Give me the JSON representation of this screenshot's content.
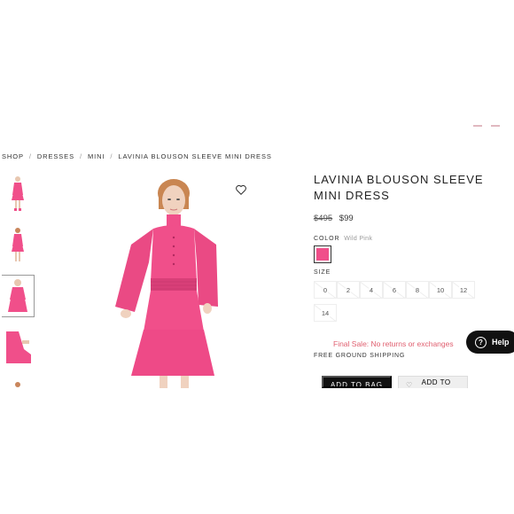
{
  "breadcrumb": [
    {
      "label": "SHOP"
    },
    {
      "label": "DRESSES"
    },
    {
      "label": "MINI"
    },
    {
      "label": "LAVINIA BLOUSON SLEEVE MINI DRESS"
    }
  ],
  "product": {
    "title": "LAVINIA BLOUSON SLEEVE MINI DRESS",
    "price_original": "$495",
    "price_sale": "$99",
    "color_label": "COLOR",
    "color_value": "Wild Pink",
    "swatch_color": "#f04f8a",
    "size_label": "SIZE",
    "sizes": [
      "0",
      "2",
      "4",
      "6",
      "8",
      "10",
      "12",
      "14"
    ],
    "final_sale": "Final Sale: No returns or exchanges",
    "shipping": "FREE GROUND SHIPPING",
    "add_to_bag": "ADD TO BAG",
    "add_to": "ADD TO"
  },
  "gallery": {
    "wishlist_icon": "heart-icon",
    "dress_color": "#f04f8a"
  },
  "help": {
    "label": "Help",
    "icon": "question-icon"
  }
}
